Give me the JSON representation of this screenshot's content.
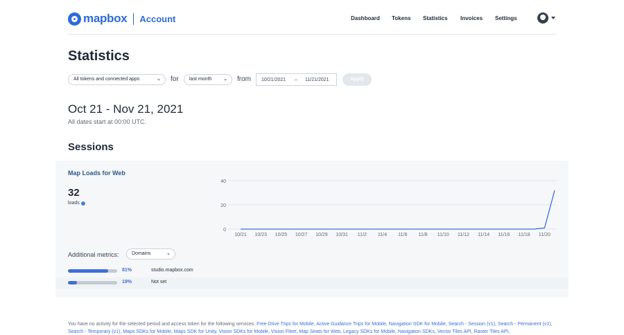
{
  "header": {
    "logo_text": "mapbox",
    "section": "Account",
    "nav": [
      "Dashboard",
      "Tokens",
      "Statistics",
      "Invoices",
      "Settings"
    ]
  },
  "page_title": "Statistics",
  "filters": {
    "token_select": "All tokens and connected apps",
    "for_label": "for",
    "period_select": "last month",
    "from_label": "from",
    "start_date": "10/21/2021",
    "date_separator": "–",
    "end_date": "11/21/2021",
    "apply_label": "Apply"
  },
  "date_range_heading": "Oct 21 - Nov 21, 2021",
  "date_range_note": "All dates start at 00:00 UTC.",
  "sessions_heading": "Sessions",
  "panel": {
    "title": "Map Loads for Web",
    "count": "32",
    "count_label": "loads",
    "additional_metrics_label": "Additional metrics:",
    "metrics_select": "Domains",
    "metrics": [
      {
        "percent_label": "81%",
        "fraction": 0.81,
        "domain": "studio.mapbox.com"
      },
      {
        "percent_label": "19%",
        "fraction": 0.19,
        "domain": "Not set"
      }
    ]
  },
  "chart_data": {
    "type": "line",
    "x": [
      "10/21",
      "10/22",
      "10/23",
      "10/24",
      "10/25",
      "10/26",
      "10/27",
      "10/28",
      "10/29",
      "10/30",
      "10/31",
      "11/1",
      "11/2",
      "11/3",
      "11/4",
      "11/5",
      "11/6",
      "11/7",
      "11/8",
      "11/9",
      "11/10",
      "11/11",
      "11/12",
      "11/13",
      "11/14",
      "11/15",
      "11/16",
      "11/17",
      "11/18",
      "11/19",
      "11/20",
      "11/21"
    ],
    "values": [
      0,
      0,
      0,
      0,
      0,
      0,
      0,
      0,
      0,
      0,
      0,
      0,
      0,
      0,
      0,
      0,
      0,
      0,
      0,
      0,
      0,
      0,
      0,
      0,
      0,
      0,
      0,
      0,
      0,
      0,
      1,
      32
    ],
    "tick_labels": [
      "10/21",
      "10/23",
      "10/25",
      "10/27",
      "10/29",
      "10/31",
      "11/2",
      "11/4",
      "11/6",
      "11/8",
      "11/10",
      "11/12",
      "11/14",
      "11/16",
      "11/18",
      "11/20"
    ],
    "y_ticks": [
      "0",
      "20",
      "40"
    ],
    "ylim": [
      0,
      40
    ],
    "grid": true,
    "color": "#3d6ed9"
  },
  "footnote": {
    "prefix": "You have no activity for the selected period and access token for the following services: ",
    "services": "Free Drive Trips for Mobile, Active Guidance Trips for Mobile, Navigation SDK for Mobile, Search - Session (v1), Search - Permanent (v1), Search - Temporary (v1), Maps SDKs for Mobile, Maps SDK for Unity, Vision SDKs for Mobile, Vision Fleet, Map Seats for Web, Legacy SDKs for Mobile, Navigation SDKs, Vector Tiles API, Raster Tiles API,"
  }
}
